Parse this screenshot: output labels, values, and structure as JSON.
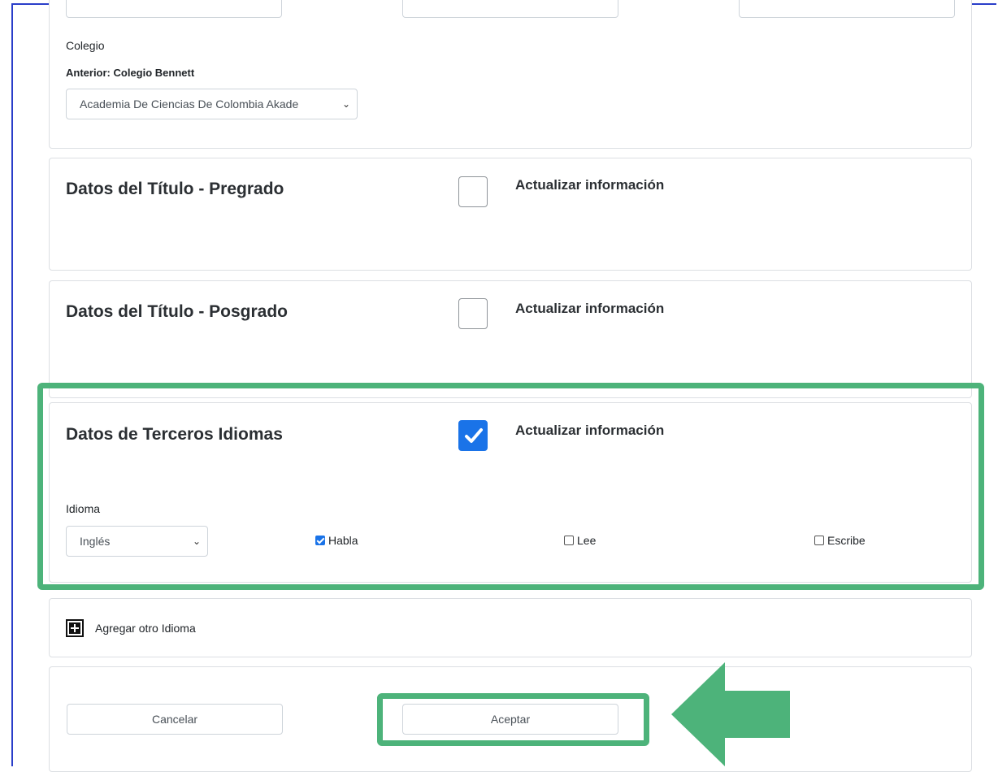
{
  "colegio": {
    "label": "Colegio",
    "previous": "Anterior: Colegio Bennett",
    "selected": "Academia De Ciencias De Colombia Akade"
  },
  "pregrado": {
    "title": "Datos del Título - Pregrado",
    "update_label": "Actualizar información",
    "checked": false
  },
  "posgrado": {
    "title": "Datos del Título - Posgrado",
    "update_label": "Actualizar información",
    "checked": false
  },
  "idiomas": {
    "title": "Datos de Terceros Idiomas",
    "update_label": "Actualizar información",
    "checked": true,
    "language_label": "Idioma",
    "language_selected": "Inglés",
    "options": [
      {
        "label": "Habla",
        "checked": true
      },
      {
        "label": "Lee",
        "checked": false
      },
      {
        "label": "Escribe",
        "checked": false
      }
    ]
  },
  "add_language": {
    "label": "Agregar otro Idioma"
  },
  "actions": {
    "cancel": "Cancelar",
    "accept": "Aceptar"
  },
  "colors": {
    "highlight": "#4db37a",
    "checkbox_blue": "#1a73e8",
    "frame_border": "#2a3ec9"
  }
}
